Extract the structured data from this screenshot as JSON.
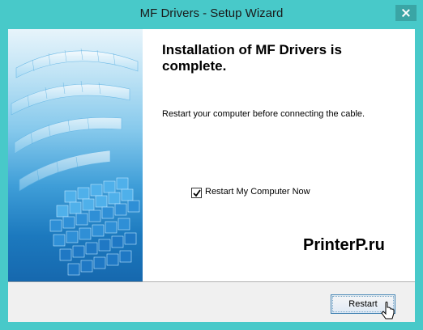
{
  "window": {
    "title": "MF Drivers - Setup Wizard"
  },
  "main": {
    "heading": "Installation of MF Drivers is complete.",
    "message": "Restart your computer before connecting the cable.",
    "restart_checkbox": {
      "label": "Restart My Computer Now",
      "checked": true
    }
  },
  "watermark": {
    "text": "PrinterP.ru"
  },
  "footer": {
    "restart_label": "Restart"
  },
  "icons": {
    "close": "close-icon",
    "check": "checkmark-icon",
    "cursor": "mouse-pointer-icon"
  },
  "colors": {
    "frame": "#48c9c9",
    "button_border": "#3c7fb1"
  }
}
